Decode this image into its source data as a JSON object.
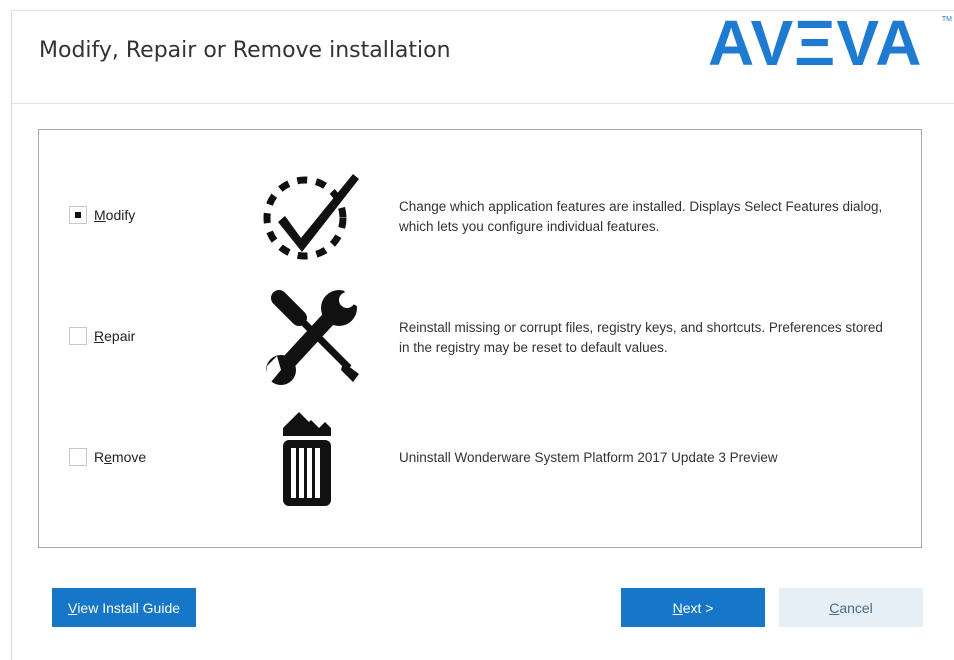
{
  "window": {
    "title": "Modify, Repair or Remove installation",
    "logo_text": "AVΞVA",
    "logo_tm": "TM",
    "brand_color": "#1f7bd1"
  },
  "options": [
    {
      "id": "modify",
      "label_mnemonic": "M",
      "label_rest": "odify",
      "checked": true,
      "icon": "dashed-circle-checkmark-icon",
      "description": "Change which application features are installed. Displays Select Features dialog, which lets you configure individual features."
    },
    {
      "id": "repair",
      "label_mnemonic": "R",
      "label_rest": "epair",
      "checked": false,
      "icon": "wrench-screwdriver-icon",
      "description": "Reinstall missing or corrupt files, registry keys, and shortcuts. Preferences stored in the registry may be reset to default values."
    },
    {
      "id": "remove",
      "label_pre": "R",
      "label_mnemonic": "e",
      "label_rest": "move",
      "checked": false,
      "icon": "trash-can-icon",
      "description": "Uninstall Wonderware System Platform 2017 Update 3 Preview"
    }
  ],
  "buttons": {
    "guide": {
      "mnemonic": "V",
      "rest": "iew Install Guide"
    },
    "next": {
      "mnemonic": "N",
      "rest": "ext >"
    },
    "cancel": {
      "mnemonic": "C",
      "rest": "ancel",
      "enabled": false
    }
  }
}
